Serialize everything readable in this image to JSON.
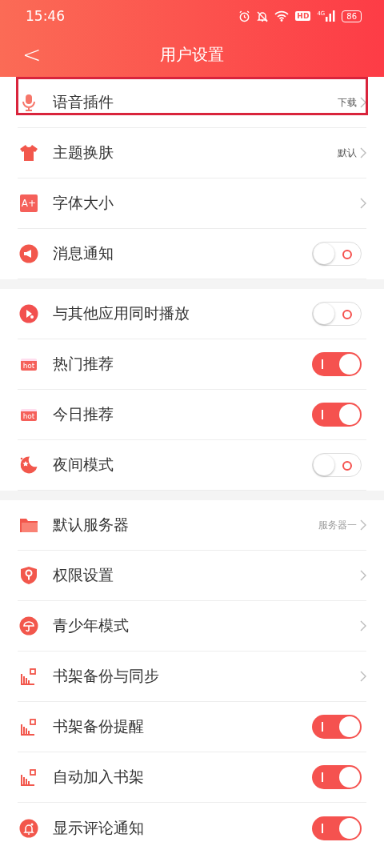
{
  "status_bar": {
    "time": "15:46",
    "hd": "HD",
    "network": "4G",
    "battery": "86"
  },
  "header": {
    "back": "<",
    "title": "用户设置"
  },
  "groups": [
    {
      "items": [
        {
          "kind": "link",
          "label": "语音插件",
          "value": "下载",
          "highlighted": true
        },
        {
          "kind": "link",
          "label": "主题换肤",
          "value": "默认",
          "highlighted": false
        },
        {
          "kind": "link",
          "label": "字体大小",
          "icon_label": "A+",
          "highlighted": false
        },
        {
          "kind": "toggle",
          "label": "消息通知",
          "on": false
        }
      ]
    },
    {
      "items": [
        {
          "kind": "toggle",
          "label": "与其他应用同时播放",
          "on": false
        },
        {
          "kind": "toggle",
          "label": "热门推荐",
          "icon_label": "hot",
          "on": true
        },
        {
          "kind": "toggle",
          "label": "今日推荐",
          "icon_label": "hot",
          "on": true
        },
        {
          "kind": "toggle",
          "label": "夜间模式",
          "on": false
        }
      ]
    },
    {
      "items": [
        {
          "kind": "link",
          "label": "默认服务器",
          "value": "服务器一",
          "highlighted": false
        },
        {
          "kind": "link",
          "label": "权限设置",
          "highlighted": false
        },
        {
          "kind": "link",
          "label": "青少年模式",
          "highlighted": false
        },
        {
          "kind": "link",
          "label": "书架备份与同步",
          "highlighted": false
        },
        {
          "kind": "toggle",
          "label": "书架备份提醒",
          "on": true
        },
        {
          "kind": "toggle",
          "label": "自动加入书架",
          "on": true
        },
        {
          "kind": "toggle",
          "label": "显示评论通知",
          "on": true
        }
      ]
    }
  ]
}
